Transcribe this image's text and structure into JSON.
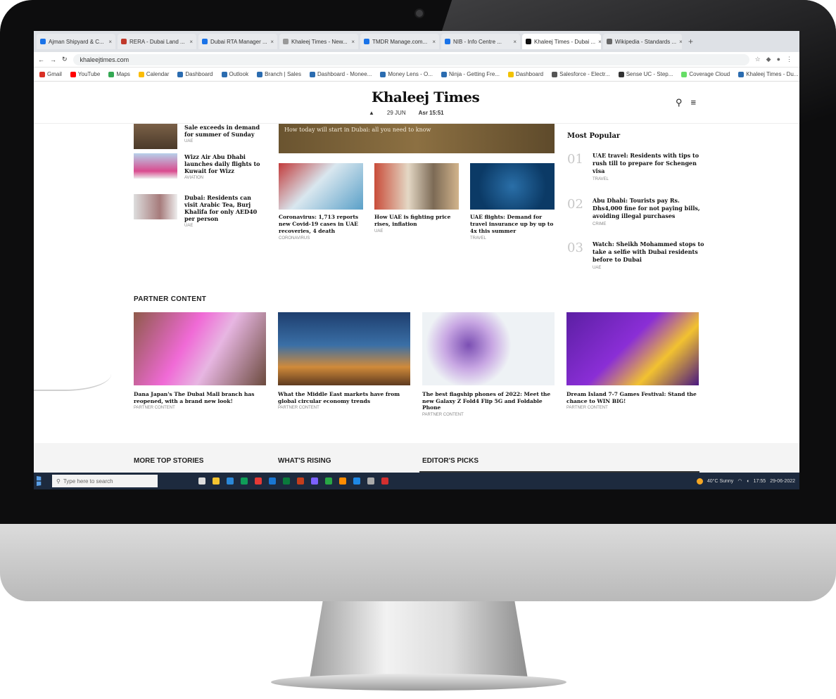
{
  "browser": {
    "tabs": [
      {
        "label": "Ajman Shipyard & C..."
      },
      {
        "label": "RERA - Dubai Land ..."
      },
      {
        "label": "Dubai RTA Manager ..."
      },
      {
        "label": "Khaleej Times - New..."
      },
      {
        "label": "TMDR Manage.com..."
      },
      {
        "label": "NIB - Info Centre ..."
      },
      {
        "label": "Khaleej Times - Dubai ..."
      },
      {
        "label": "Wikipedia - Standards ..."
      }
    ],
    "new_tab": "+",
    "url": "khaleejtimes.com",
    "bookmarks": [
      {
        "label": "Gmail"
      },
      {
        "label": "YouTube"
      },
      {
        "label": "Maps"
      },
      {
        "label": "Calendar"
      },
      {
        "label": "Dashboard"
      },
      {
        "label": "Outlook"
      },
      {
        "label": "Branch | Sales"
      },
      {
        "label": "Dashboard - Monee..."
      },
      {
        "label": "Money Lens - O..."
      },
      {
        "label": "Ninja - Getting Fre..."
      },
      {
        "label": "Dashboard"
      },
      {
        "label": "Salesforce - Electr..."
      },
      {
        "label": "Sense UC - Step..."
      },
      {
        "label": "Coverage Cloud"
      },
      {
        "label": "Khaleej Times - Du..."
      }
    ]
  },
  "site": {
    "logo": "Khaleej Times",
    "prayer_label": "Asr 15:51",
    "prayer_date": "29 JUN"
  },
  "left_list": [
    {
      "title": "Sale exceeds in demand for summer of Sunday",
      "tag": "UAE"
    },
    {
      "title": "Wizz Air Abu Dhabi launches daily flights to Kuwait for Wizz",
      "tag": "AVIATION"
    },
    {
      "title": "Dubai: Residents can visit Arabic Tea, Burj Khalifa for only AED40 per person",
      "tag": "UAE"
    }
  ],
  "hero_banner": "How today will start in Dubai: all you need to know",
  "center_cards": [
    {
      "title": "Coronavirus: 1,713 reports new Covid-19 cases in UAE recoveries, 4 death",
      "tag": "CORONAVIRUS"
    },
    {
      "title": "How UAE is fighting price rises, inflation",
      "tag": "UAE"
    },
    {
      "title": "UAE flights: Demand for travel insurance up by up to 4x this summer",
      "tag": "TRAVEL"
    }
  ],
  "most_popular": {
    "title": "Most Popular",
    "items": [
      {
        "num": "01",
        "title": "UAE travel: Residents with tips to rush till to prepare for Schengen visa",
        "tag": "TRAVEL"
      },
      {
        "num": "02",
        "title": "Abu Dhabi: Tourists pay Rs. Dhs4,000 fine for not paying bills, avoiding illegal purchases",
        "tag": "CRIME"
      },
      {
        "num": "03",
        "title": "Watch: Sheikh Mohammed stops to take a selfie with Dubai residents before to Dubai",
        "tag": "UAE"
      }
    ]
  },
  "partner": {
    "title": "PARTNER CONTENT",
    "cards": [
      {
        "title": "Dana Japan's The Dubai Mall branch has reopened, with a brand new look!",
        "tag": "PARTNER CONTENT"
      },
      {
        "title": "What the Middle East markets have from global circular economy trends",
        "tag": "PARTNER CONTENT"
      },
      {
        "title": "The best flagship phones of 2022: Meet the new Galaxy Z Fold4 Flip 5G and Foldable Phone",
        "tag": "PARTNER CONTENT"
      },
      {
        "title": "Dream Island 7-7 Games Festival: Stand the chance to WIN BIG!",
        "tag": "PARTNER CONTENT"
      }
    ]
  },
  "bottom_sections": {
    "more_top": "MORE TOP STORIES",
    "whats_rising": "WHAT'S RISING",
    "editors_picks": "EDITOR'S PICKS"
  },
  "taskbar": {
    "search_placeholder": "Type here to search",
    "weather": "40°C Sunny",
    "time": "17:55",
    "date": "29-06-2022"
  }
}
